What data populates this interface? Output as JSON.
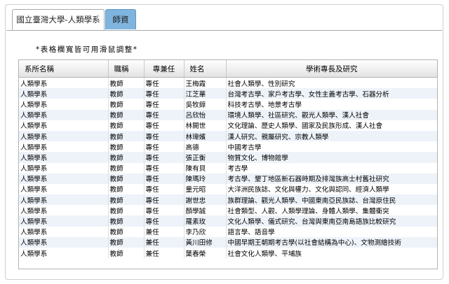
{
  "tabs": [
    {
      "label": "國立臺灣大學-人類學系"
    },
    {
      "label": "師資"
    }
  ],
  "hint": "*表格欄寬皆可用滑鼠調整*",
  "table": {
    "headers": [
      "系所名稱",
      "職稱",
      "專兼任",
      "姓名",
      "學術專長及研究"
    ],
    "rows": [
      [
        "人類學系",
        "教師",
        "專任",
        "王梅霞",
        "社會人類學、性別研究"
      ],
      [
        "人類學系",
        "教師",
        "專任",
        "江芝華",
        "台灣考古學、家戶考古學、女性主義考古學、石器分析"
      ],
      [
        "人類學系",
        "教師",
        "專任",
        "吳牧錞",
        "科技考古學、地景考古學"
      ],
      [
        "人類學系",
        "教師",
        "專任",
        "呂欣怡",
        "環境人類學、社區研究、觀光人類學、漢人社會"
      ],
      [
        "人類學系",
        "教師",
        "專任",
        "林開世",
        "文化理論、歷史人類學、國家及民族形成、漢人社會"
      ],
      [
        "人類學系",
        "教師",
        "專任",
        "林瑋嬪",
        "漢人研究、親屬研究、宗教人類學"
      ],
      [
        "人類學系",
        "教師",
        "專任",
        "高德",
        "中國考古學"
      ],
      [
        "人類學系",
        "教師",
        "專任",
        "張正衡",
        "物質文化、博物館學"
      ],
      [
        "人類學系",
        "教師",
        "專任",
        "陳有貝",
        "考古學"
      ],
      [
        "人類學系",
        "教師",
        "專任",
        "陳瑪玲",
        "考古學、墾丁地區新石器時期及排灣族高士村舊社研究"
      ],
      [
        "人類學系",
        "教師",
        "專任",
        "童元昭",
        "大洋洲民族誌、文化與權力、文化與認同、經濟人類學"
      ],
      [
        "人類學系",
        "教師",
        "專任",
        "謝世忠",
        "族群理論、觀光人類學、中國東南亞民族誌、台灣原住民"
      ],
      [
        "人類學系",
        "教師",
        "專任",
        "顏學誠",
        "社會類型、人觀、人類學理論、身體人類學、集體衝突"
      ],
      [
        "人類學系",
        "教師",
        "專任",
        "羅素玫",
        "文化人類學、儀式研究、台灣與東南亞南島語族比較研究"
      ],
      [
        "人類學系",
        "教師",
        "兼任",
        "李乃欣",
        "語言學、語音學"
      ],
      [
        "人類學系",
        "教師",
        "兼任",
        "黃川田修",
        "中國早期王朝期考古學(以社會結構為中心)、文物測繪技術"
      ],
      [
        "人類學系",
        "教師",
        "兼任",
        "葉春榮",
        "社會文化人類學、平埔族"
      ]
    ]
  }
}
